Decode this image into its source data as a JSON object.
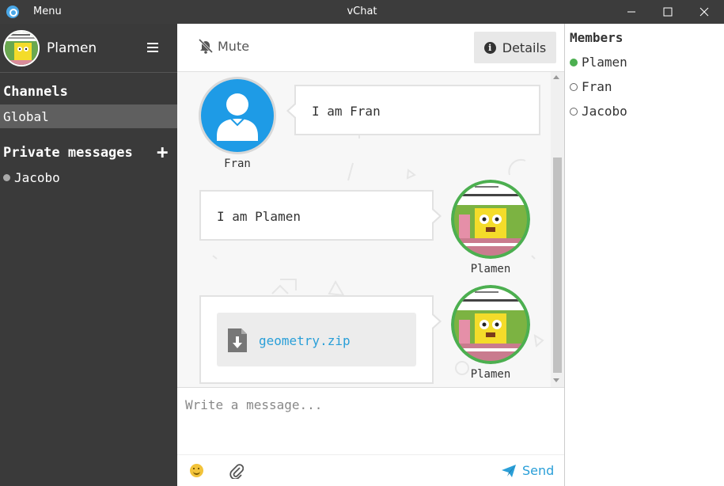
{
  "window": {
    "menu_label": "Menu",
    "title": "vChat"
  },
  "sidebar": {
    "user_name": "Plamen",
    "channels_title": "Channels",
    "channels": [
      {
        "label": "Global",
        "selected": true
      }
    ],
    "private_title": "Private messages",
    "private": [
      {
        "label": "Jacobo",
        "status": "offline"
      }
    ]
  },
  "toolbar": {
    "mute_label": "Mute",
    "details_label": "Details"
  },
  "messages": [
    {
      "author": "Fran",
      "text": "I am Fran",
      "side": "left",
      "avatar": "default-user-icon"
    },
    {
      "author": "Plamen",
      "text": "I am Plamen",
      "side": "right",
      "avatar": "spongebob-meme-avatar"
    },
    {
      "author": "Plamen",
      "file": "geometry.zip",
      "side": "right",
      "avatar": "spongebob-meme-avatar"
    }
  ],
  "composer": {
    "placeholder": "Write a message...",
    "send_label": "Send"
  },
  "members": {
    "title": "Members",
    "list": [
      {
        "name": "Plamen",
        "status": "online"
      },
      {
        "name": "Fran",
        "status": "offline"
      },
      {
        "name": "Jacobo",
        "status": "offline"
      }
    ]
  },
  "colors": {
    "accent": "#2a9fd8",
    "online": "#4caf50",
    "avatar_ring": "#4caf50",
    "default_avatar_bg": "#1e9be6",
    "sidebar_bg": "#3a3a3a"
  }
}
